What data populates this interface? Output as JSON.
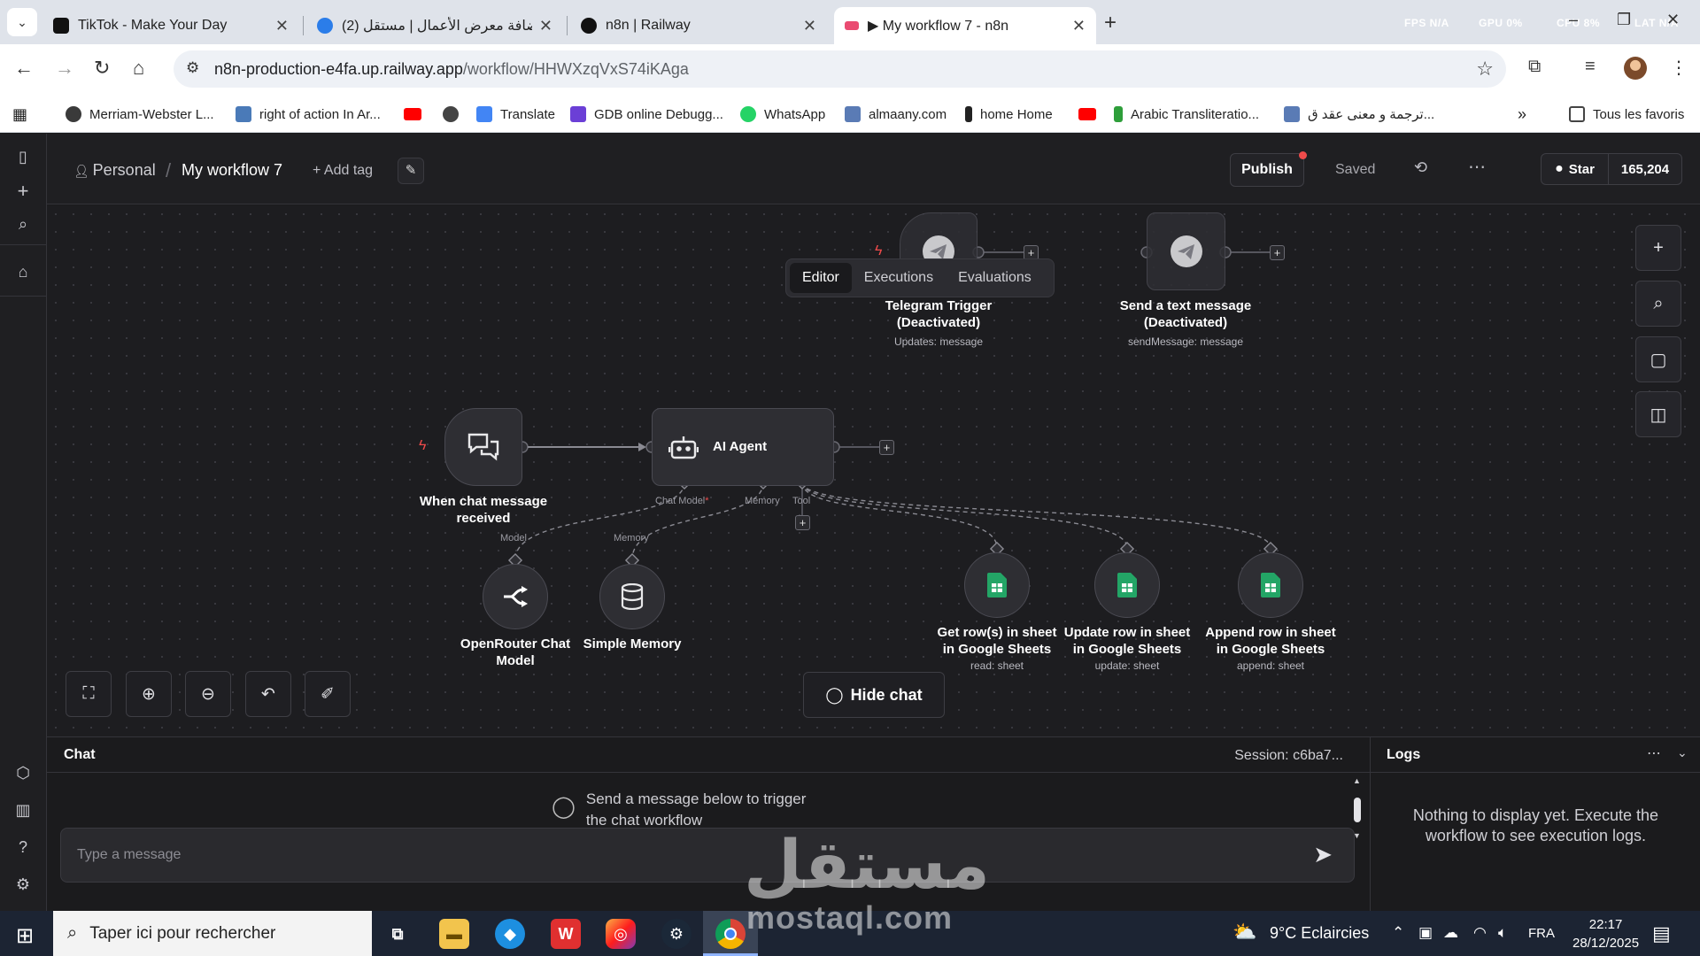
{
  "browser": {
    "tabs": [
      {
        "title": "TikTok - Make Your Day",
        "color": "#111111"
      },
      {
        "title": "(2) إضافة معرض الأعمال | مستقل",
        "color": "#2b7de9"
      },
      {
        "title": "n8n | Railway",
        "color": "#111111"
      },
      {
        "title": "▶ My workflow 7 - n8n",
        "color": "#ea4b71"
      }
    ],
    "perf": {
      "fps": "FPS N/A",
      "gpu": "GPU 0%",
      "cpu": "CPU 8%",
      "lat": "LAT N/A"
    },
    "url": {
      "host": "n8n-production-e4fa.up.railway.app",
      "path": "/workflow/HHWXzqVxS74iKAga"
    },
    "bookmarks": [
      {
        "label": "Merriam-Webster L...",
        "color": "#3a3a3a"
      },
      {
        "label": "right of action In Ar...",
        "color": "#4a7ab8"
      },
      {
        "label": "",
        "color": "#ff0000"
      },
      {
        "label": "",
        "color": "#444444"
      },
      {
        "label": "Translate",
        "color": "#4285f4"
      },
      {
        "label": "GDB online Debugg...",
        "color": "#6b3fd6"
      },
      {
        "label": "WhatsApp",
        "color": "#25d366"
      },
      {
        "label": "almaany.com",
        "color": "#5a7bb5"
      },
      {
        "label": "home Home",
        "color": "#222222"
      },
      {
        "label": "",
        "color": "#ff0000"
      },
      {
        "label": "Arabic Transliteratio...",
        "color": "#2e9e3a"
      },
      {
        "label": "ترجمة و معنى عقد ق...",
        "color": "#5a7bb5"
      }
    ],
    "all_bookmarks": "Tous les favoris"
  },
  "header": {
    "personal": "Personal",
    "workflow_title": "My workflow 7",
    "add_tag": "+ Add tag",
    "publish": "Publish",
    "saved": "Saved",
    "github_star": "Star",
    "github_count": "165,204"
  },
  "modes": [
    "Editor",
    "Executions",
    "Evaluations"
  ],
  "nodes": {
    "telegram_trigger": {
      "title": "Telegram Trigger\n(Deactivated)",
      "sub": "Updates: message"
    },
    "send_text": {
      "title": "Send a text message\n(Deactivated)",
      "sub": "sendMessage: message"
    },
    "chat_trigger": {
      "title": "When chat message\nreceived"
    },
    "ai_agent": {
      "title": "AI Agent",
      "ports": [
        "Chat Model",
        "Memory",
        "Tool"
      ]
    },
    "openrouter": {
      "title": "OpenRouter Chat\nModel",
      "port": "Model"
    },
    "memory": {
      "title": "Simple Memory",
      "port": "Memory"
    },
    "get_rows": {
      "title": "Get row(s) in sheet\nin Google Sheets",
      "sub": "read: sheet"
    },
    "update_row": {
      "title": "Update row in sheet\nin Google Sheets",
      "sub": "update: sheet"
    },
    "append_row": {
      "title": "Append row in sheet\nin Google Sheets",
      "sub": "append: sheet"
    }
  },
  "hide_chat": "Hide chat",
  "chat": {
    "title": "Chat",
    "session": "Session: c6ba7...",
    "empty": "Send a message below to trigger\nthe chat workflow",
    "placeholder": "Type a message"
  },
  "logs": {
    "title": "Logs",
    "empty": "Nothing to display yet. Execute the workflow to see execution logs."
  },
  "watermark": {
    "arabic": "مستقل",
    "latin": "mostaql.com"
  },
  "taskbar": {
    "search_placeholder": "Taper ici pour rechercher",
    "weather": "9°C  Eclaircies",
    "lang": "FRA",
    "time": "22:17",
    "date": "28/12/2025"
  }
}
